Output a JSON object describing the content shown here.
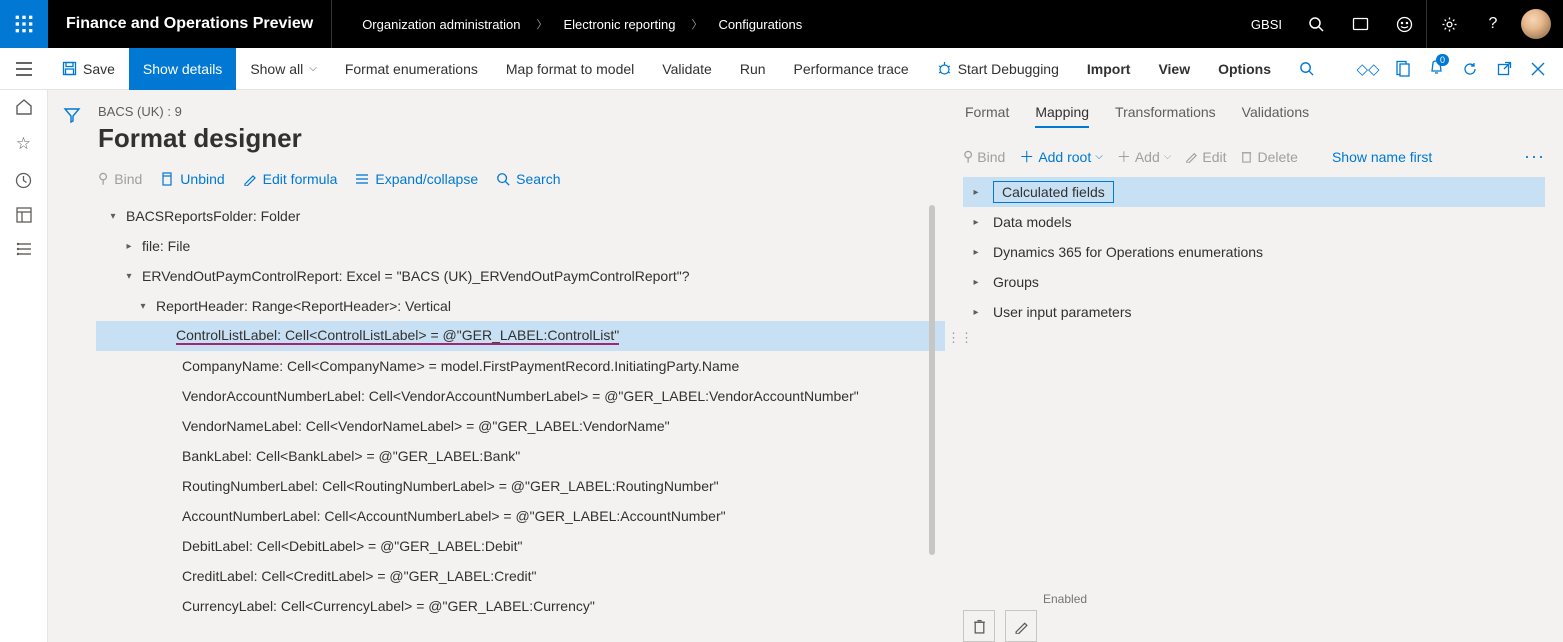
{
  "topbar": {
    "app_title": "Finance and Operations Preview",
    "breadcrumb": [
      "Organization administration",
      "Electronic reporting",
      "Configurations"
    ],
    "company": "GBSI"
  },
  "cmdbar": {
    "save": "Save",
    "show_details": "Show details",
    "show_all": "Show all",
    "format_enum": "Format enumerations",
    "map_model": "Map format to model",
    "validate": "Validate",
    "run": "Run",
    "perf": "Performance trace",
    "debug": "Start Debugging",
    "import": "Import",
    "view": "View",
    "options": "Options",
    "notif_badge": "0"
  },
  "page": {
    "crumb": "BACS (UK) : 9",
    "title": "Format designer"
  },
  "toolbar": {
    "bind": "Bind",
    "unbind": "Unbind",
    "edit_formula": "Edit formula",
    "expand": "Expand/collapse",
    "search": "Search"
  },
  "tree": [
    {
      "level": 0,
      "caret": "▾",
      "label": "BACSReportsFolder: Folder",
      "selected": false
    },
    {
      "level": 1,
      "caret": "▸",
      "label": "file: File",
      "selected": false
    },
    {
      "level": 2,
      "caret": "▾",
      "label": "ERVendOutPaymControlReport: Excel = \"BACS (UK)_ERVendOutPaymControlReport\"?",
      "selected": false
    },
    {
      "level": 25,
      "caret": "▾",
      "label": "ReportHeader: Range<ReportHeader>: Vertical",
      "selected": false
    },
    {
      "level": 3,
      "caret": "",
      "label": "ControlListLabel: Cell<ControlListLabel> = @\"GER_LABEL:ControlList\"",
      "selected": true,
      "underline": true
    },
    {
      "level": 4,
      "caret": "",
      "label": "CompanyName: Cell<CompanyName> = model.FirstPaymentRecord.InitiatingParty.Name"
    },
    {
      "level": 4,
      "caret": "",
      "label": "VendorAccountNumberLabel: Cell<VendorAccountNumberLabel> = @\"GER_LABEL:VendorAccountNumber\""
    },
    {
      "level": 4,
      "caret": "",
      "label": "VendorNameLabel: Cell<VendorNameLabel> = @\"GER_LABEL:VendorName\""
    },
    {
      "level": 4,
      "caret": "",
      "label": "BankLabel: Cell<BankLabel> = @\"GER_LABEL:Bank\""
    },
    {
      "level": 4,
      "caret": "",
      "label": "RoutingNumberLabel: Cell<RoutingNumberLabel> = @\"GER_LABEL:RoutingNumber\""
    },
    {
      "level": 4,
      "caret": "",
      "label": "AccountNumberLabel: Cell<AccountNumberLabel> = @\"GER_LABEL:AccountNumber\""
    },
    {
      "level": 4,
      "caret": "",
      "label": "DebitLabel: Cell<DebitLabel> = @\"GER_LABEL:Debit\""
    },
    {
      "level": 4,
      "caret": "",
      "label": "CreditLabel: Cell<CreditLabel> = @\"GER_LABEL:Credit\""
    },
    {
      "level": 4,
      "caret": "",
      "label": "CurrencyLabel: Cell<CurrencyLabel> = @\"GER_LABEL:Currency\""
    }
  ],
  "tabs": [
    "Format",
    "Mapping",
    "Transformations",
    "Validations"
  ],
  "active_tab": "Mapping",
  "rtoolbar": {
    "bind": "Bind",
    "add_root": "Add root",
    "add": "Add",
    "edit": "Edit",
    "delete": "Delete",
    "show_name": "Show name first"
  },
  "rtree": [
    {
      "caret": "▸",
      "label": "Calculated fields",
      "selected": true
    },
    {
      "caret": "▸",
      "label": "Data models"
    },
    {
      "caret": "▸",
      "label": "Dynamics 365 for Operations enumerations"
    },
    {
      "caret": "▸",
      "label": "Groups"
    },
    {
      "caret": "▸",
      "label": "User input parameters"
    }
  ],
  "props": {
    "label": "Enabled"
  }
}
